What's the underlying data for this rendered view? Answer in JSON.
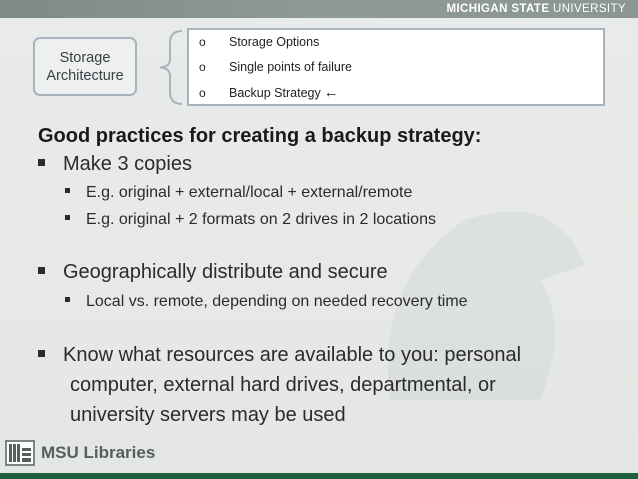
{
  "header": {
    "brand_bold": "MICHIGAN STATE",
    "brand_regular": " UNIVERSITY"
  },
  "architecture": {
    "line1": "Storage",
    "line2": "Architecture"
  },
  "options": [
    {
      "bullet": "o",
      "label": "Storage Options"
    },
    {
      "bullet": "o",
      "label": "Single points of failure"
    },
    {
      "bullet": "o",
      "label": "Backup Strategy",
      "arrow": "←"
    }
  ],
  "content": {
    "heading": "Good practices for creating a backup strategy:",
    "item1": "Make 3 copies",
    "item1_sub1": "E.g. original + external/local + external/remote",
    "item1_sub2": "E.g. original + 2 formats on 2 drives in 2 locations",
    "item2": "Geographically distribute and secure",
    "item2_sub1": "Local vs. remote, depending on needed recovery time",
    "item3_line1": "Know what resources are available to you: personal",
    "item3_line2": "computer, external hard drives, departmental, or",
    "item3_line3": "university servers may be used"
  },
  "footer": {
    "logo_text": "MSU Libraries"
  },
  "colors": {
    "topbar": "#8b9693",
    "footer_green": "#1f5f3d",
    "box_border": "#a9b3bd"
  }
}
